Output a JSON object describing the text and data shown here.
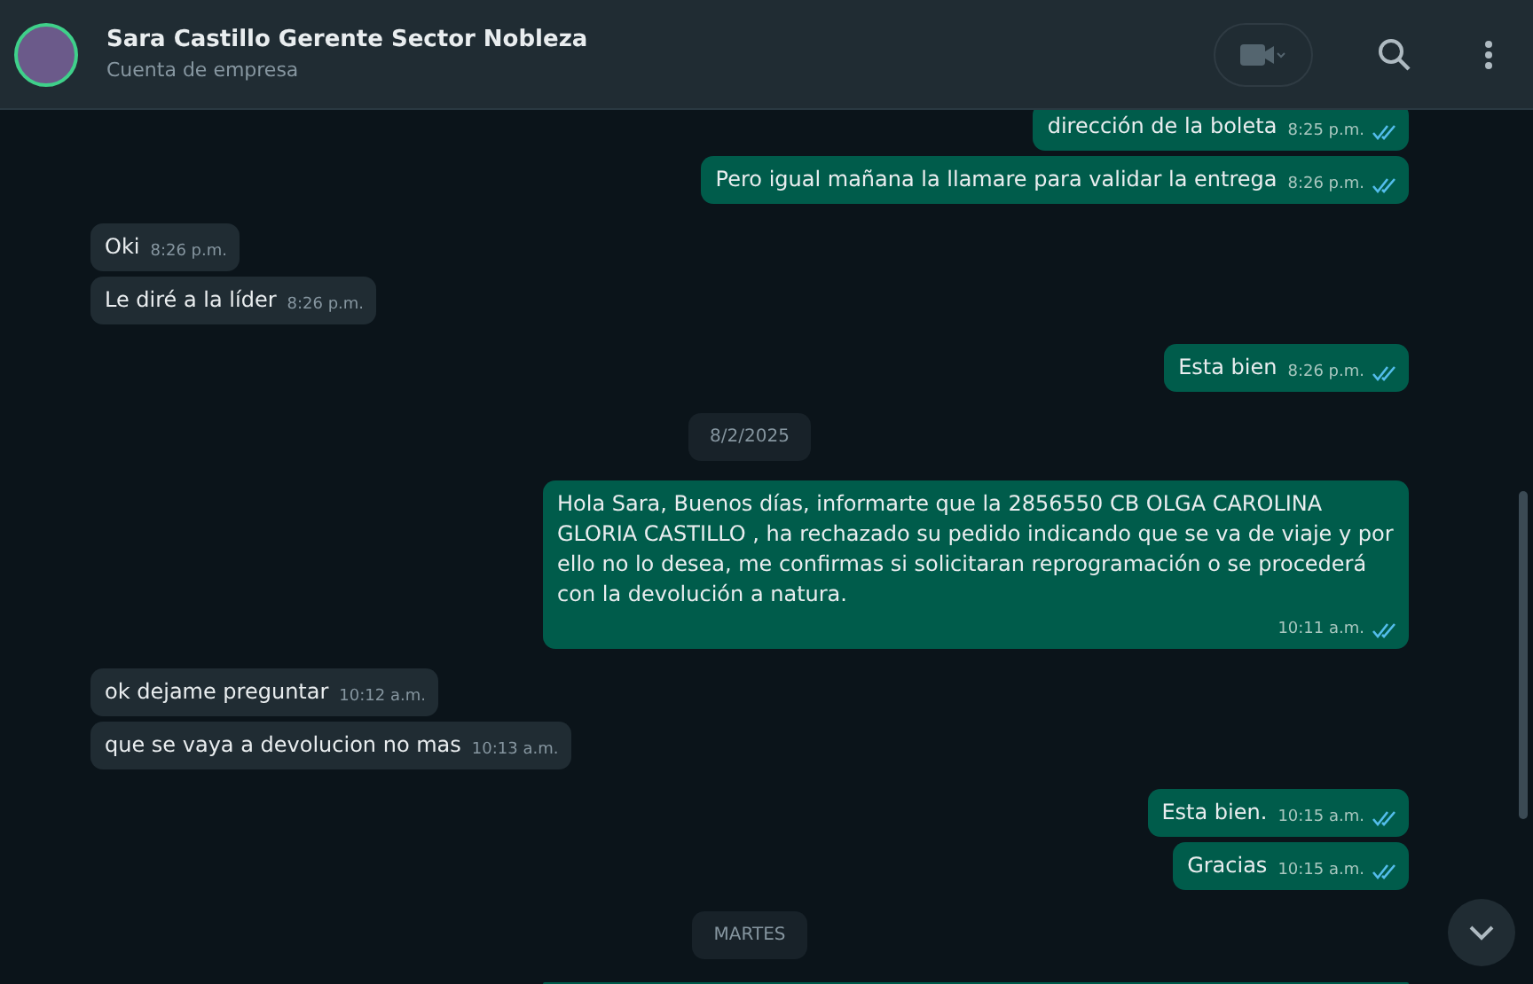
{
  "header": {
    "name": "Sara Castillo Gerente Sector Nobleza",
    "subtitle": "Cuenta de empresa"
  },
  "messages": [
    {
      "kind": "out",
      "text": "dirección de la boleta",
      "time": "8:25 p.m.",
      "read": true
    },
    {
      "kind": "out",
      "text": "Pero igual mañana la llamare para validar la entrega",
      "time": "8:26 p.m.",
      "read": true
    },
    {
      "kind": "in",
      "text": "Oki",
      "time": "8:26 p.m."
    },
    {
      "kind": "in",
      "text": "Le diré a la líder",
      "time": "8:26 p.m."
    },
    {
      "kind": "out",
      "text": "Esta bien",
      "time": "8:26 p.m.",
      "read": true
    },
    {
      "kind": "date",
      "text": "8/2/2025"
    },
    {
      "kind": "out",
      "text": "Hola Sara, Buenos días, informarte que la 2856550 CB OLGA CAROLINA  GLORIA CASTILLO , ha rechazado su pedido indicando que se va de viaje y por ello no lo desea, me confirmas si solicitaran reprogramación o se procederá con la devolución a natura.",
      "time": "10:11 a.m.",
      "read": true
    },
    {
      "kind": "in",
      "text": "ok dejame preguntar",
      "time": "10:12 a.m."
    },
    {
      "kind": "in",
      "text": "que se vaya a devolucion no mas",
      "time": "10:13 a.m."
    },
    {
      "kind": "out",
      "text": "Esta bien.",
      "time": "10:15 a.m.",
      "read": true
    },
    {
      "kind": "out",
      "text": "Gracias",
      "time": "10:15 a.m.",
      "read": true
    },
    {
      "kind": "date",
      "text": "MARTES"
    }
  ]
}
